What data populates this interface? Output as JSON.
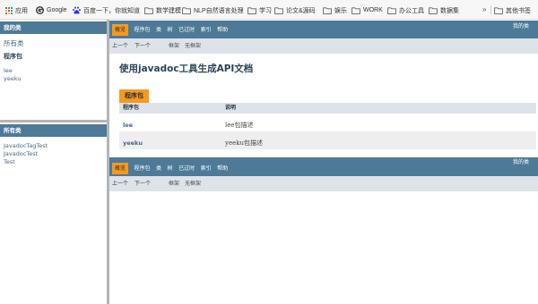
{
  "bookmarks": {
    "items": [
      {
        "label": "应用",
        "icon": "apps-grid-icon"
      },
      {
        "label": "Google",
        "icon": "google-icon"
      },
      {
        "label": "百度一下，你就知道",
        "icon": "baidu-paw-icon"
      },
      {
        "label": "数学建模",
        "icon": "folder-icon"
      },
      {
        "label": "NLP自然语言处理",
        "icon": "folder-icon"
      },
      {
        "label": "学习",
        "icon": "folder-icon"
      },
      {
        "label": "论文&源码",
        "icon": "folder-icon"
      },
      {
        "label": "娱乐",
        "icon": "folder-icon"
      },
      {
        "label": "WORK",
        "icon": "folder-icon"
      },
      {
        "label": "办公工具",
        "icon": "folder-icon"
      },
      {
        "label": "数据集",
        "icon": "folder-icon"
      }
    ],
    "overflow_label": "»",
    "other_bookmarks": {
      "label": "其他书签",
      "icon": "folder-icon"
    }
  },
  "left_frame": {
    "packages_panel": {
      "header": "我的类",
      "all_classes_link": "所有类",
      "heading": "程序包",
      "packages": [
        "lee",
        "yeeku"
      ]
    },
    "classes_panel": {
      "header": "所有类",
      "classes": [
        "JavadocTagTest",
        "JavadocTest",
        "Test"
      ]
    }
  },
  "nav": {
    "items": [
      {
        "label": "概览",
        "active": true
      },
      {
        "label": "程序包",
        "active": false
      },
      {
        "label": "类",
        "active": false
      },
      {
        "label": "树",
        "active": false
      },
      {
        "label": "已过时",
        "active": false
      },
      {
        "label": "索引",
        "active": false
      },
      {
        "label": "帮助",
        "active": false
      }
    ],
    "about": "我的类",
    "subnav": {
      "prev": "上一个",
      "next": "下一个",
      "frames": "框架",
      "no_frames": "无框架"
    }
  },
  "overview": {
    "title": "使用javadoc工具生成API文档",
    "table_caption": "程序包",
    "columns": [
      "程序包",
      "说明"
    ],
    "rows": [
      {
        "package": "lee",
        "description": "lee包描述"
      },
      {
        "package": "yeeku",
        "description": "yeeku包描述"
      }
    ]
  },
  "colors": {
    "nav_bar": "#4d7a97",
    "active_tab": "#f8981d",
    "sub_nav": "#dee3e9",
    "table_header": "#dee3e9",
    "alt_row": "#eeeeef",
    "link": "#4a6782",
    "heading": "#2c4557",
    "frame_divider": "#b5b5b5"
  }
}
